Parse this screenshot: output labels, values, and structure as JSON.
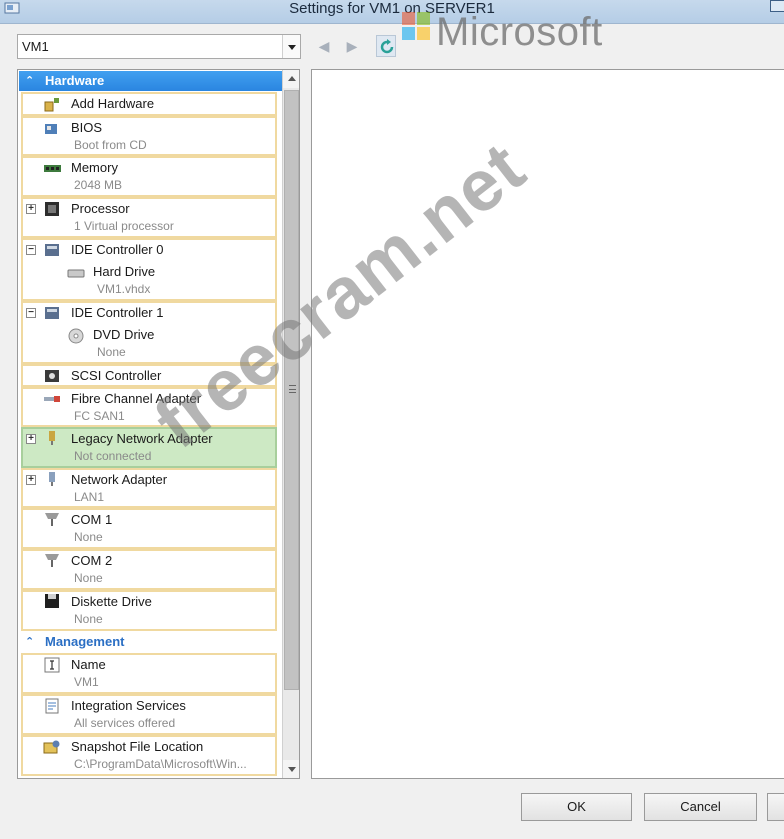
{
  "window": {
    "title": "Settings for VM1 on SERVER1"
  },
  "vm_selector": {
    "value": "VM1"
  },
  "logo": {
    "wordmark": "Microsoft"
  },
  "watermark": {
    "text": "freecram.net"
  },
  "tree": {
    "hardware_header": "Hardware",
    "management_header": "Management",
    "hardware": [
      {
        "label": "Add Hardware",
        "sub": "",
        "icon": "add-hardware-icon"
      },
      {
        "label": "BIOS",
        "sub": "Boot from CD",
        "icon": "bios-icon"
      },
      {
        "label": "Memory",
        "sub": "2048 MB",
        "icon": "memory-icon"
      },
      {
        "label": "Processor",
        "sub": "1 Virtual processor",
        "icon": "processor-icon"
      },
      {
        "label": "IDE Controller 0",
        "child": "Hard Drive",
        "child_sub": "VM1.vhdx",
        "icon": "ide-controller-icon"
      },
      {
        "label": "IDE Controller 1",
        "child": "DVD Drive",
        "child_sub": "None",
        "icon": "ide-controller-icon"
      },
      {
        "label": "SCSI Controller",
        "sub": "",
        "icon": "scsi-controller-icon"
      },
      {
        "label": "Fibre Channel Adapter",
        "sub": "FC SAN1",
        "icon": "fibre-channel-icon"
      },
      {
        "label": "Legacy Network Adapter",
        "sub": "Not connected",
        "icon": "network-adapter-icon"
      },
      {
        "label": "Network Adapter",
        "sub": "LAN1",
        "icon": "network-adapter-icon"
      },
      {
        "label": "COM 1",
        "sub": "None",
        "icon": "com-port-icon"
      },
      {
        "label": "COM 2",
        "sub": "None",
        "icon": "com-port-icon"
      },
      {
        "label": "Diskette Drive",
        "sub": "None",
        "icon": "diskette-icon"
      }
    ],
    "management": [
      {
        "label": "Name",
        "sub": "VM1",
        "icon": "name-icon"
      },
      {
        "label": "Integration Services",
        "sub": "All services offered",
        "icon": "integration-services-icon"
      },
      {
        "label": "Snapshot File Location",
        "sub": "C:\\ProgramData\\Microsoft\\Win...",
        "icon": "snapshot-icon"
      }
    ]
  },
  "buttons": {
    "ok": "OK",
    "cancel": "Cancel"
  },
  "colors": {
    "hardware_header": "#2a85e0",
    "selected_item": "#cde9c4",
    "item_border": "#f0d9a0"
  }
}
